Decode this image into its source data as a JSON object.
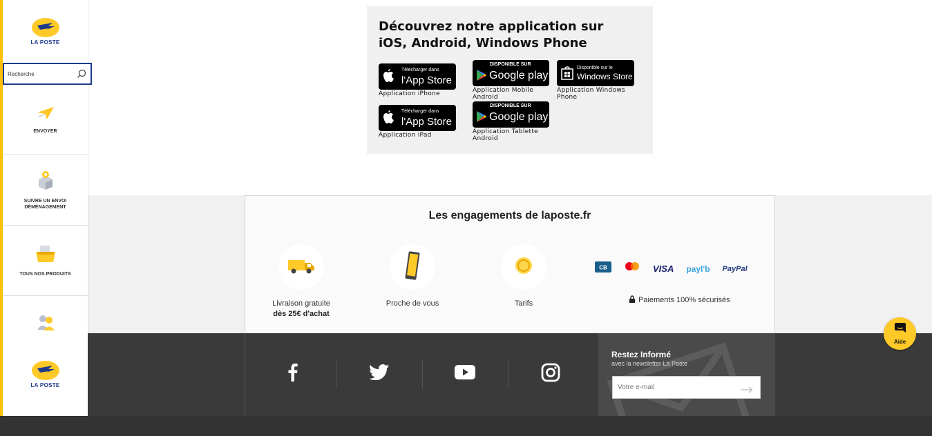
{
  "sidebar": {
    "logo_text": "LA POSTE",
    "search_value": "Recherche",
    "items": [
      {
        "label": "ENVOYER"
      },
      {
        "label": "SUIVRE UN ENVOI DÉMÉNAGEMENT"
      },
      {
        "label": "TOUS NOS PRODUITS"
      }
    ],
    "bottom_logo_text": "LA POSTE"
  },
  "app_section": {
    "title": "Découvrez notre application sur iOS, Android, Windows Phone",
    "badges": [
      {
        "small": "Télécharger dans",
        "big": "l'App Store",
        "caption": "Application iPhone"
      },
      {
        "small": "DISPONIBLE SUR",
        "big": "Google play",
        "caption": "Application Mobile Android"
      },
      {
        "small": "Disponible sur le",
        "big": "Windows Store",
        "caption": "Application Windows Phone"
      },
      {
        "small": "Télécharger dans",
        "big": "l'App Store",
        "caption": "Application iPad"
      },
      {
        "small": "DISPONIBLE SUR",
        "big": "Google play",
        "caption": "Application Tablette Android"
      }
    ]
  },
  "commitments": {
    "title": "Les engagements de laposte.fr",
    "items": [
      {
        "line1": "Livraison gratuite",
        "line2": "dès 25€ d'achat"
      },
      {
        "line1": "Proche de vous",
        "line2": ""
      },
      {
        "line1": "Tarifs",
        "line2": ""
      }
    ],
    "payments": [
      "CB",
      "mastercard",
      "VISA",
      "paylib",
      "PayPal"
    ],
    "secure_text": "Paiements 100% sécurisés"
  },
  "footer": {
    "socials": [
      "facebook-icon",
      "twitter-icon",
      "youtube-icon",
      "instagram-icon"
    ],
    "newsletter_title": "Restez Informé",
    "newsletter_sub": "avec la newsletter La Poste",
    "email_placeholder": "Votre e-mail"
  },
  "help": {
    "label": "Aide"
  },
  "colors": {
    "brand_yellow": "#ffc928",
    "brand_blue": "#1d3a8a",
    "footer_dark": "#3a3a3a"
  }
}
